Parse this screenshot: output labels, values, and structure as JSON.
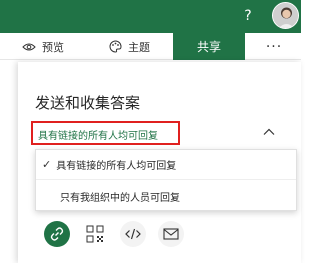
{
  "header": {
    "help_label": "?",
    "avatar_alt": "user avatar"
  },
  "toolbar": {
    "preview_label": "预览",
    "theme_label": "主题",
    "share_label": "共享",
    "more_label": "···"
  },
  "panel": {
    "title": "发送和收集答案",
    "scope_selected": "具有链接的所有人均可回复",
    "options": [
      {
        "label": "具有链接的所有人均可回复",
        "checked": true
      },
      {
        "label": "只有我组织中的人员可回复",
        "checked": false
      }
    ],
    "share_methods": [
      "link-icon",
      "qr-code-icon",
      "embed-icon",
      "mail-icon"
    ]
  },
  "colors": {
    "brand_green": "#207346",
    "highlight_red": "#e0201f"
  }
}
